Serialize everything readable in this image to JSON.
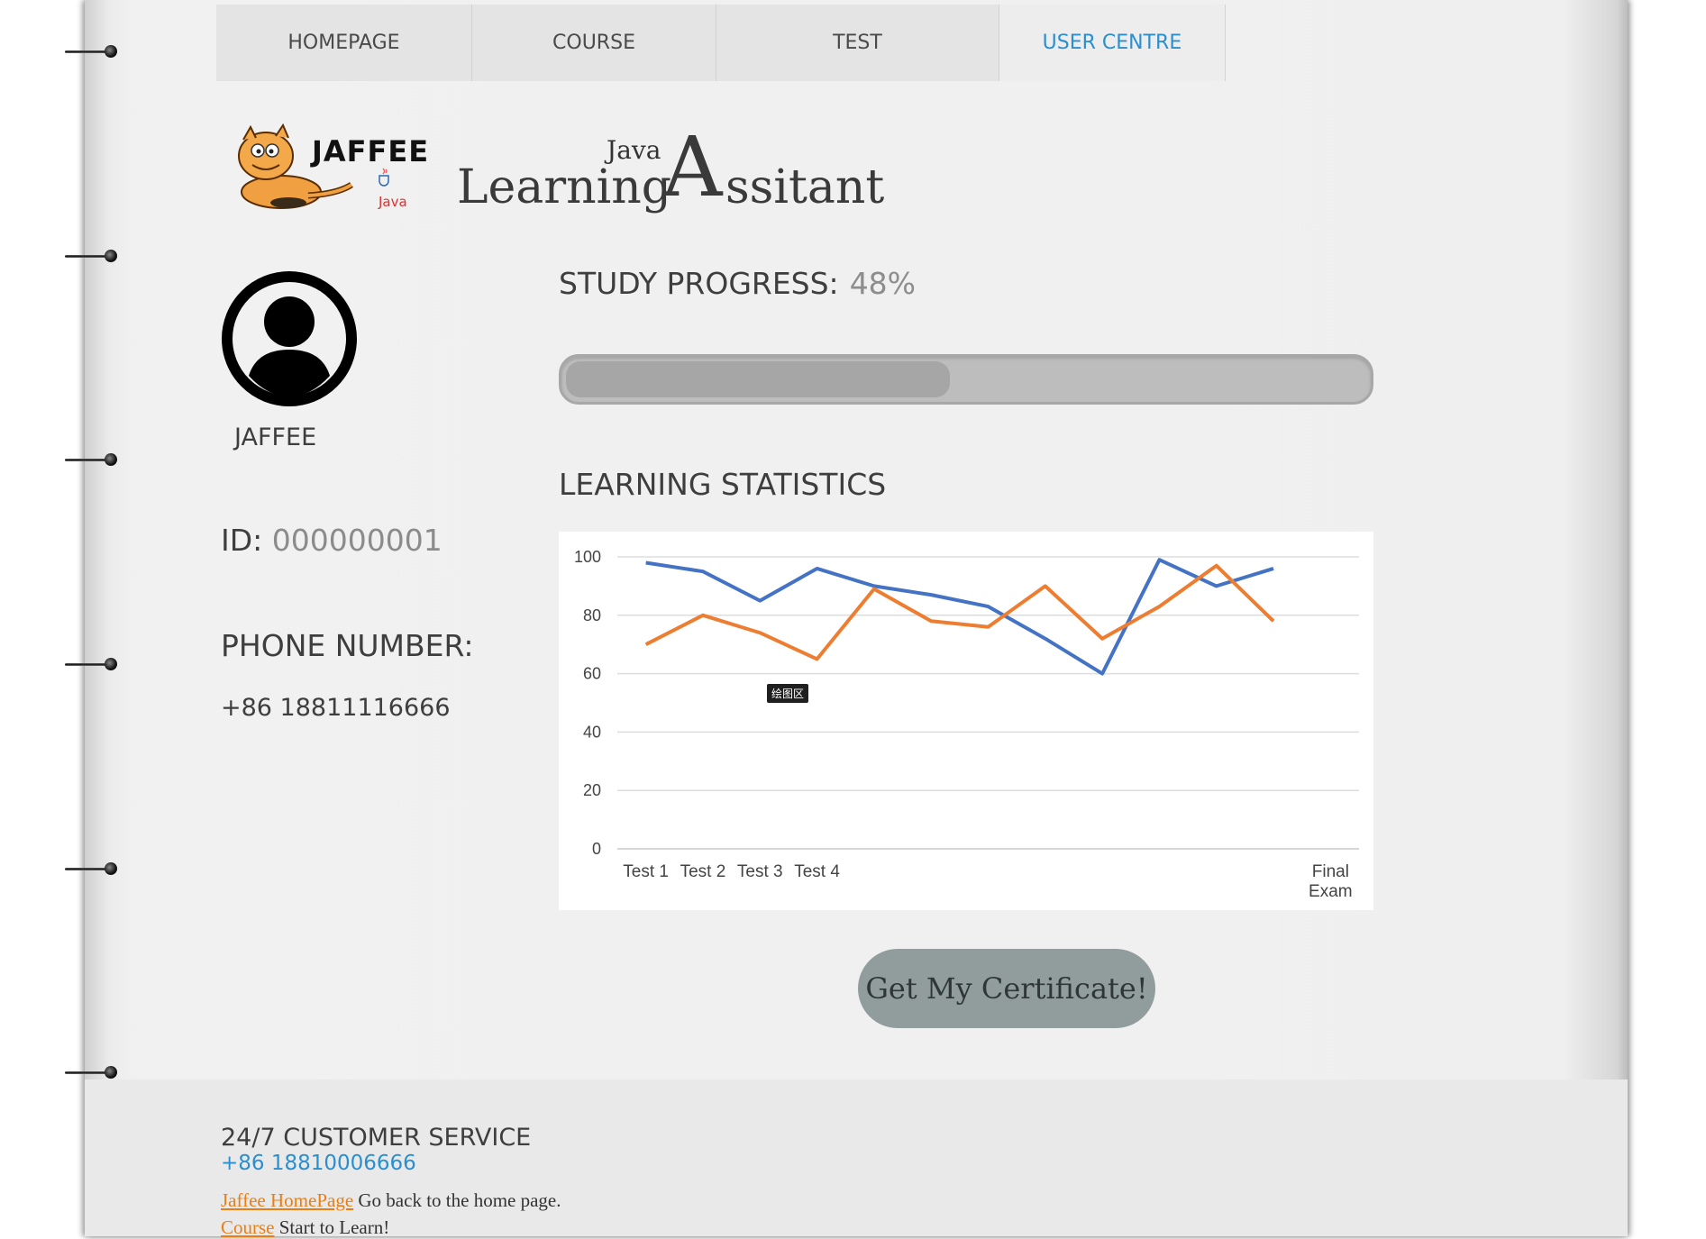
{
  "nav": {
    "items": [
      {
        "label": "HOMEPAGE",
        "active": false
      },
      {
        "label": "COURSE",
        "active": false
      },
      {
        "label": "TEST",
        "active": false
      },
      {
        "label": "USER CENTRE",
        "active": true
      }
    ]
  },
  "brand": {
    "logo_text": "JAFFEE",
    "logo_sub": "Java",
    "java": "Java",
    "learning": "Learning",
    "big_a": "A",
    "rest": "ssitant"
  },
  "profile": {
    "username": "JAFFEE",
    "id_label": "ID:",
    "id_value": "000000001",
    "phone_label": "PHONE NUMBER:",
    "phone_value": "+86 18811116666"
  },
  "progress": {
    "label": "STUDY PROGRESS:",
    "percent_text": "48%",
    "value": 0.48
  },
  "stats": {
    "label": "LEARNING STATISTICS",
    "tooltip": "绘图区"
  },
  "chart_data": {
    "type": "line",
    "categories": [
      "Test 1",
      "Test 2",
      "Test 3",
      "Test 4",
      "",
      "",
      "",
      "",
      "",
      "",
      "",
      "",
      "Final Exam"
    ],
    "category_labels": [
      "Test 1",
      "Test 2",
      "Test 3",
      "Test 4",
      "",
      "",
      "",
      "",
      "",
      "",
      "",
      "",
      "Final|Exam"
    ],
    "series": [
      {
        "values": [
          98,
          95,
          85,
          96,
          90,
          87,
          83,
          72,
          60,
          99,
          90,
          96
        ],
        "color": "#4472c4"
      },
      {
        "values": [
          70,
          80,
          74,
          65,
          89,
          78,
          76,
          90,
          72,
          83,
          97,
          78
        ],
        "color": "#ed7d31"
      }
    ],
    "ylim": [
      0,
      100
    ],
    "yticks": [
      0,
      20,
      40,
      60,
      80,
      100
    ],
    "grid": true
  },
  "certificate_button": "Get My Certificate!",
  "footer": {
    "cs_label": "24/7 CUSTOMER SERVICE",
    "cs_phone": "+86 18810006666",
    "links": [
      {
        "link": "Jaffee HomePage",
        "text": " Go back to the home page."
      },
      {
        "link": "Course",
        "text": " Start to Learn!"
      }
    ]
  },
  "colors": {
    "accent": "#2a8fcf",
    "link": "#e97f12",
    "button": "#919d9c"
  }
}
